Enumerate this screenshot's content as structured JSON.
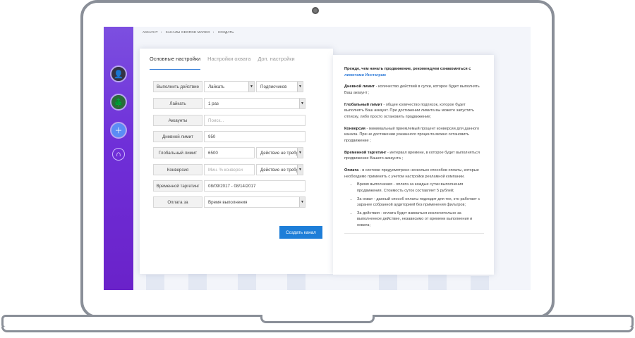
{
  "breadcrumb": [
    "АККАУНТ",
    "КАНАЛЫ GEORGE MARKO",
    "СОЗДАТЬ"
  ],
  "breadcrumb_sep": "›",
  "tabs": [
    {
      "label": "Основные настройки"
    },
    {
      "label": "Настройки охвата"
    },
    {
      "label": "Доп. настройки"
    }
  ],
  "form": {
    "action": {
      "label": "Выполнить действие",
      "value": "Лайкать",
      "value2": "Подписчиков"
    },
    "likes": {
      "label": "Лайкать",
      "value": "1 раз"
    },
    "accounts": {
      "label": "Аккаунты",
      "placeholder": "Поиск..."
    },
    "daily": {
      "label": "Дневной лимит",
      "value": "950"
    },
    "global": {
      "label": "Глобальный лимит",
      "value": "6500",
      "value2": "Действие не требу"
    },
    "conversion": {
      "label": "Конверсия",
      "placeholder": "Мин. % конверси",
      "value2": "Действие не требу"
    },
    "time": {
      "label": "Временной таргетинг",
      "value": "08/09/2017 - 08/14/2017"
    },
    "payment": {
      "label": "Оплата за",
      "value": "Время выполнения"
    },
    "submit": "Создать канал"
  },
  "info": {
    "intro": "Прежде, чем начать продвижение, рекомендуем ознакомиться с",
    "intro_link": "лимитами Инстаграм",
    "daily_title": "Дневной лимит",
    "daily_text": " - количество действий в сутки, которое будет выполнять Ваш аккаунт ;",
    "global_title": "Глобальный лимит",
    "global_text": " - общее количество подписок, которое будет выполнять Ваш аккаунт. При достижении лимита вы можете запустить отписку, либо просто остановить продвижение;",
    "conv_title": "Конверсия",
    "conv_text": " - минимальный приемлемый процент конверсии для данного канала. При не достижении указанного процента можно остановить продвижение ;",
    "time_title": "Временной таргетинг",
    "time_text": " - интервал времени, в которое будет выполняться продвижение Вашего аккаунта ;",
    "pay_title": "Оплата",
    "pay_text": " - в системе предусмотрено несколько способов оплаты, которые необходимо применять с учетом настройки рекламной компании.",
    "bullets": [
      "Время выполнения - оплата за каждые сутки выполнения продвижения. Стоимость суток составляет 5 рублей;",
      "За охват - данный способ оплаты подходит для тех, кто работает с заранее собранной аудиторией без применения фильтров;",
      "За действия - оплата будет взиматься исключительно за выполненное действие, независимо от времени выполнения и охвата;"
    ]
  },
  "colors": {
    "accent": "#1e7ed8",
    "sidebar_top": "#7c4fe0",
    "sidebar_bottom": "#6a22c9"
  }
}
